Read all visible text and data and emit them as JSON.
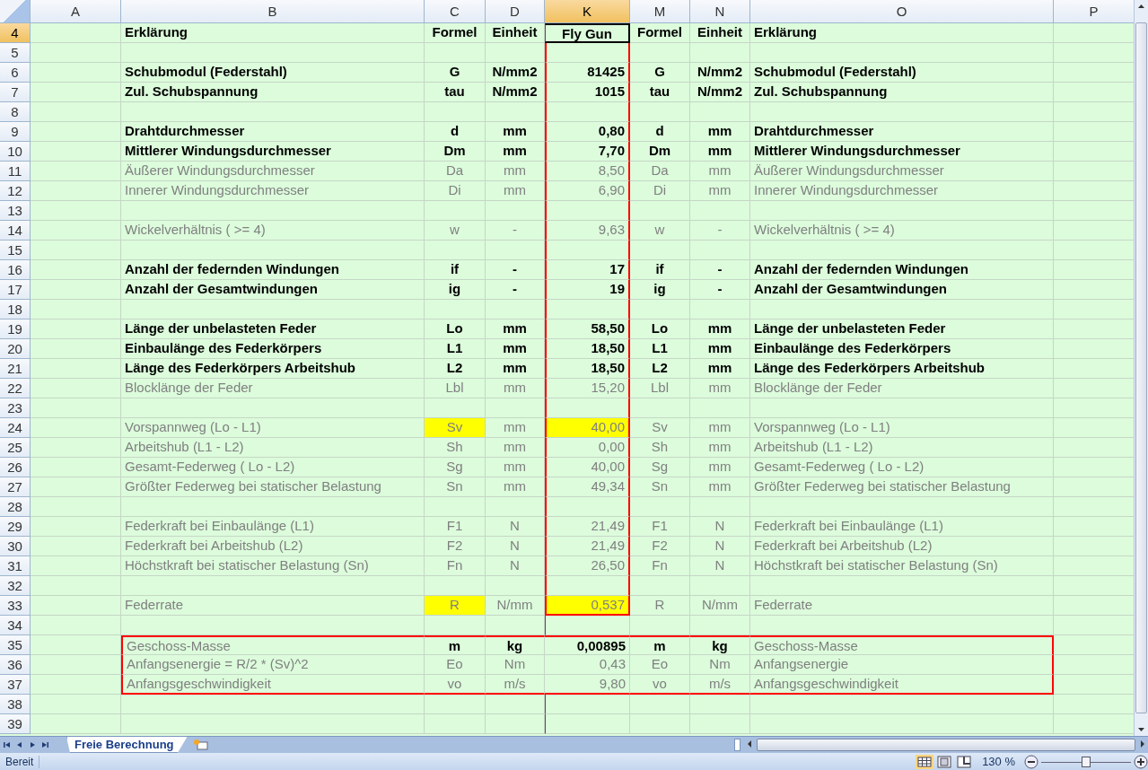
{
  "columns": [
    {
      "label": "A",
      "selected": false
    },
    {
      "label": "B",
      "selected": false
    },
    {
      "label": "C",
      "selected": false
    },
    {
      "label": "D",
      "selected": false
    },
    {
      "label": "K",
      "selected": true
    },
    {
      "label": "M",
      "selected": false
    },
    {
      "label": "N",
      "selected": false
    },
    {
      "label": "O",
      "selected": false
    },
    {
      "label": "P",
      "selected": false
    }
  ],
  "rows": [
    {
      "number": "4",
      "kind": "bold",
      "selected": true,
      "highlighted": false,
      "value_outlined": false,
      "outlined": false,
      "cells": [
        "Erklärung",
        "Formel",
        "Einheit",
        "Fly Gun",
        "Formel",
        "Einheit",
        "Erklärung"
      ]
    },
    {
      "number": "5",
      "selected": false,
      "value_outlined": true,
      "outlined": false,
      "cells": []
    },
    {
      "number": "6",
      "kind": "bold",
      "selected": false,
      "highlighted": false,
      "value_outlined": true,
      "outlined": false,
      "cells": [
        "Schubmodul (Federstahl)",
        "G",
        "N/mm2",
        "81425",
        "G",
        "N/mm2",
        "Schubmodul (Federstahl)"
      ]
    },
    {
      "number": "7",
      "kind": "bold",
      "selected": false,
      "highlighted": false,
      "value_outlined": true,
      "outlined": false,
      "cells": [
        "Zul. Schubspannung",
        "tau",
        "N/mm2",
        "1015",
        "tau",
        "N/mm2",
        "Zul. Schubspannung"
      ]
    },
    {
      "number": "8",
      "selected": false,
      "value_outlined": true,
      "outlined": false,
      "cells": []
    },
    {
      "number": "9",
      "kind": "bold",
      "selected": false,
      "highlighted": false,
      "value_outlined": true,
      "outlined": false,
      "cells": [
        "Drahtdurchmesser",
        "d",
        "mm",
        "0,80",
        "d",
        "mm",
        "Drahtdurchmesser"
      ]
    },
    {
      "number": "10",
      "kind": "bold",
      "selected": false,
      "highlighted": false,
      "value_outlined": true,
      "outlined": false,
      "cells": [
        "Mittlerer Windungsdurchmesser",
        "Dm",
        "mm",
        "7,70",
        "Dm",
        "mm",
        "Mittlerer Windungsdurchmesser"
      ]
    },
    {
      "number": "11",
      "kind": "normal",
      "selected": false,
      "highlighted": false,
      "value_outlined": true,
      "outlined": false,
      "cells": [
        "Äußerer Windungsdurchmesser",
        "Da",
        "mm",
        "8,50",
        "Da",
        "mm",
        "Äußerer Windungsdurchmesser"
      ]
    },
    {
      "number": "12",
      "kind": "normal",
      "selected": false,
      "highlighted": false,
      "value_outlined": true,
      "outlined": false,
      "cells": [
        "Innerer Windungsdurchmesser",
        "Di",
        "mm",
        "6,90",
        "Di",
        "mm",
        "Innerer Windungsdurchmesser"
      ]
    },
    {
      "number": "13",
      "selected": false,
      "value_outlined": true,
      "outlined": false,
      "cells": []
    },
    {
      "number": "14",
      "kind": "normal",
      "selected": false,
      "highlighted": false,
      "value_outlined": true,
      "outlined": false,
      "cells": [
        "Wickelverhältnis ( >= 4)",
        "w",
        "-",
        "9,63",
        "w",
        "-",
        "Wickelverhältnis ( >= 4)"
      ]
    },
    {
      "number": "15",
      "selected": false,
      "value_outlined": true,
      "outlined": false,
      "cells": []
    },
    {
      "number": "16",
      "kind": "bold",
      "selected": false,
      "highlighted": false,
      "value_outlined": true,
      "outlined": false,
      "cells": [
        "Anzahl der federnden Windungen",
        "if",
        "-",
        "17",
        "if",
        "-",
        "Anzahl der federnden Windungen"
      ]
    },
    {
      "number": "17",
      "kind": "bold",
      "selected": false,
      "highlighted": false,
      "value_outlined": true,
      "outlined": false,
      "cells": [
        "Anzahl der Gesamtwindungen",
        "ig",
        "-",
        "19",
        "ig",
        "-",
        "Anzahl der Gesamtwindungen"
      ]
    },
    {
      "number": "18",
      "selected": false,
      "value_outlined": true,
      "outlined": false,
      "cells": []
    },
    {
      "number": "19",
      "kind": "bold",
      "selected": false,
      "highlighted": false,
      "value_outlined": true,
      "outlined": false,
      "cells": [
        "Länge der unbelasteten Feder",
        "Lo",
        "mm",
        "58,50",
        "Lo",
        "mm",
        "Länge der unbelasteten Feder"
      ]
    },
    {
      "number": "20",
      "kind": "bold",
      "selected": false,
      "highlighted": false,
      "value_outlined": true,
      "outlined": false,
      "cells": [
        "Einbaulänge des Federkörpers",
        "L1",
        "mm",
        "18,50",
        "L1",
        "mm",
        "Einbaulänge des Federkörpers"
      ]
    },
    {
      "number": "21",
      "kind": "bold",
      "selected": false,
      "highlighted": false,
      "value_outlined": true,
      "outlined": false,
      "cells": [
        "Länge des Federkörpers Arbeitshub",
        "L2",
        "mm",
        "18,50",
        "L2",
        "mm",
        "Länge des Federkörpers Arbeitshub"
      ]
    },
    {
      "number": "22",
      "kind": "normal",
      "selected": false,
      "highlighted": false,
      "value_outlined": true,
      "outlined": false,
      "cells": [
        "Blocklänge der Feder",
        "Lbl",
        "mm",
        "15,20",
        "Lbl",
        "mm",
        "Blocklänge der Feder"
      ]
    },
    {
      "number": "23",
      "selected": false,
      "value_outlined": true,
      "outlined": false,
      "cells": []
    },
    {
      "number": "24",
      "kind": "normal",
      "selected": false,
      "highlighted": true,
      "value_outlined": true,
      "outlined": false,
      "cells": [
        "Vorspannweg (Lo - L1)",
        "Sv",
        "mm",
        "40,00",
        "Sv",
        "mm",
        "Vorspannweg (Lo - L1)"
      ]
    },
    {
      "number": "25",
      "kind": "normal",
      "selected": false,
      "highlighted": false,
      "value_outlined": true,
      "outlined": false,
      "cells": [
        "Arbeitshub (L1 - L2)",
        "Sh",
        "mm",
        "0,00",
        "Sh",
        "mm",
        "Arbeitshub (L1 - L2)"
      ]
    },
    {
      "number": "26",
      "kind": "normal",
      "selected": false,
      "highlighted": false,
      "value_outlined": true,
      "outlined": false,
      "cells": [
        "Gesamt-Federweg ( Lo - L2)",
        "Sg",
        "mm",
        "40,00",
        "Sg",
        "mm",
        "Gesamt-Federweg ( Lo - L2)"
      ]
    },
    {
      "number": "27",
      "kind": "normal",
      "selected": false,
      "highlighted": false,
      "value_outlined": true,
      "outlined": false,
      "cells": [
        "Größter Federweg bei statischer Belastung",
        "Sn",
        "mm",
        "49,34",
        "Sn",
        "mm",
        "Größter Federweg bei statischer Belastung"
      ]
    },
    {
      "number": "28",
      "selected": false,
      "value_outlined": true,
      "outlined": false,
      "cells": []
    },
    {
      "number": "29",
      "kind": "normal",
      "selected": false,
      "highlighted": false,
      "value_outlined": true,
      "outlined": false,
      "cells": [
        "Federkraft bei Einbaulänge (L1)",
        "F1",
        "N",
        "21,49",
        "F1",
        "N",
        "Federkraft bei Einbaulänge (L1)"
      ]
    },
    {
      "number": "30",
      "kind": "normal",
      "selected": false,
      "highlighted": false,
      "value_outlined": true,
      "outlined": false,
      "cells": [
        "Federkraft bei Arbeitshub (L2)",
        "F2",
        "N",
        "21,49",
        "F2",
        "N",
        "Federkraft bei Arbeitshub (L2)"
      ]
    },
    {
      "number": "31",
      "kind": "normal",
      "selected": false,
      "highlighted": false,
      "value_outlined": true,
      "outlined": false,
      "cells": [
        "Höchstkraft bei statischer Belastung (Sn)",
        "Fn",
        "N",
        "26,50",
        "Fn",
        "N",
        "Höchstkraft bei statischer Belastung (Sn)"
      ]
    },
    {
      "number": "32",
      "selected": false,
      "value_outlined": true,
      "outlined": false,
      "cells": []
    },
    {
      "number": "33",
      "kind": "normal",
      "selected": false,
      "highlighted": true,
      "value_outlined": true,
      "outlined": false,
      "cells": [
        "Federrate",
        "R",
        "N/mm",
        "0,537",
        "R",
        "N/mm",
        "Federrate"
      ]
    },
    {
      "number": "34",
      "selected": false,
      "value_outlined": false,
      "outlined": false,
      "cells": []
    },
    {
      "number": "35",
      "kind": "mixed",
      "selected": false,
      "highlighted": false,
      "value_outlined": false,
      "outlined": true,
      "cells": [
        "Geschoss-Masse",
        "m",
        "kg",
        "0,00895",
        "m",
        "kg",
        "Geschoss-Masse"
      ]
    },
    {
      "number": "36",
      "kind": "normal",
      "selected": false,
      "highlighted": false,
      "value_outlined": false,
      "outlined": true,
      "cells": [
        "Anfangsenergie = R/2 * (Sv)^2",
        "Eo",
        "Nm",
        "0,43",
        "Eo",
        "Nm",
        "Anfangsenergie"
      ]
    },
    {
      "number": "37",
      "kind": "normal",
      "selected": false,
      "highlighted": false,
      "value_outlined": false,
      "outlined": true,
      "cells": [
        "Anfangsgeschwindigkeit",
        "vo",
        "m/s",
        "9,80",
        "vo",
        "m/s",
        "Anfangsgeschwindigkeit"
      ]
    },
    {
      "number": "38",
      "selected": false,
      "value_outlined": false,
      "outlined": false,
      "cells": []
    },
    {
      "number": "39",
      "selected": false,
      "value_outlined": false,
      "outlined": false,
      "cells": []
    }
  ],
  "sheet_tabs": [
    {
      "label": "Freie Berechnung",
      "selected": true
    }
  ],
  "status_bar": {
    "text": "Bereit",
    "zoom": "130 %",
    "zoom_slider": {
      "level": 0.5
    },
    "views": [
      {
        "selected": true
      },
      {
        "selected": false
      },
      {
        "selected": false
      }
    ]
  }
}
